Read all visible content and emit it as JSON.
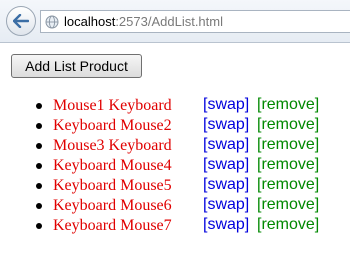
{
  "browser": {
    "url_host": "localhost",
    "url_rest": ":2573/AddList.html"
  },
  "page": {
    "add_button_label": "Add List Product",
    "swap_label": "[swap]",
    "remove_label": "[remove]",
    "items": [
      {
        "name": "Mouse1 Keyboard"
      },
      {
        "name": "Keyboard Mouse2"
      },
      {
        "name": "Mouse3 Keyboard"
      },
      {
        "name": "Keyboard Mouse4"
      },
      {
        "name": "Keyboard Mouse5"
      },
      {
        "name": "Keyboard Mouse6"
      },
      {
        "name": "Keyboard Mouse7"
      }
    ]
  },
  "colors": {
    "product_text": "#e00000",
    "swap_link": "#0000dd",
    "remove_link": "#008800"
  },
  "icons": {
    "back": "back-arrow-icon",
    "site": "globe-icon"
  }
}
